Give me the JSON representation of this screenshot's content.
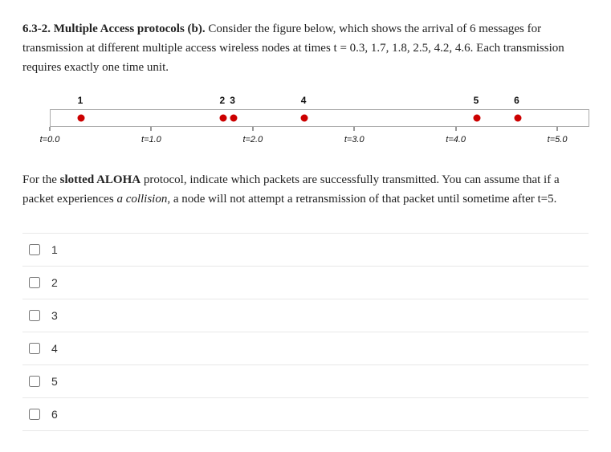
{
  "question": {
    "number": "6.3-2.",
    "title": "Multiple Access protocols (b).",
    "prompt": "Consider the figure below, which shows the arrival of 6 messages for transmission at different multiple access wireless nodes at times  t = 0.3, 1.7, 1.8, 2.5, 4.2, 4.6. Each transmission requires exactly one time unit."
  },
  "timeline": {
    "messages": [
      {
        "label": "1",
        "t": 0.3
      },
      {
        "label": "2",
        "t": 1.7
      },
      {
        "label": "3",
        "t": 1.8
      },
      {
        "label": "4",
        "t": 2.5
      },
      {
        "label": "5",
        "t": 4.2
      },
      {
        "label": "6",
        "t": 4.6
      }
    ],
    "tick_labels": [
      "t=0.0",
      "t=1.0",
      "t=2.0",
      "t=3.0",
      "t=4.0",
      "t=5.0"
    ]
  },
  "followup": {
    "pre": "For the ",
    "bold": "slotted ALOHA",
    "mid": " protocol, indicate which packets are successfully transmitted. You can assume that if a packet experiences ",
    "ital": "a collision",
    "post": ", a node will not attempt a retransmission of that packet until sometime after t=5."
  },
  "options": [
    "1",
    "2",
    "3",
    "4",
    "5",
    "6"
  ]
}
